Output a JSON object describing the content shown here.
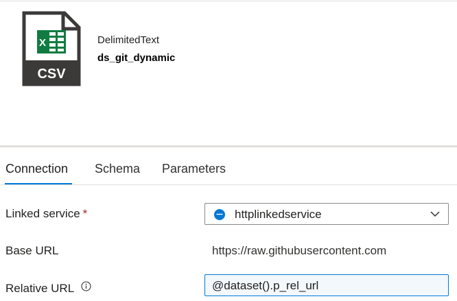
{
  "dataset": {
    "type": "DelimitedText",
    "name": "ds_git_dynamic",
    "icon": "csv-file-icon",
    "icon_label": "CSV"
  },
  "tabs": [
    {
      "label": "Connection",
      "active": true
    },
    {
      "label": "Schema",
      "active": false
    },
    {
      "label": "Parameters",
      "active": false
    }
  ],
  "connection": {
    "linked_service": {
      "label": "Linked service",
      "required_marker": "*",
      "value": "httplinkedservice",
      "icon": "http-service-icon"
    },
    "base_url": {
      "label": "Base URL",
      "value": "https://raw.githubusercontent.com"
    },
    "relative_url": {
      "label": "Relative URL",
      "value": "@dataset().p_rel_url",
      "icon": "info-icon"
    }
  },
  "colors": {
    "accent": "#0078d4",
    "excel_green": "#107c41",
    "file_border": "#3b3a39",
    "required": "#a4262c"
  }
}
